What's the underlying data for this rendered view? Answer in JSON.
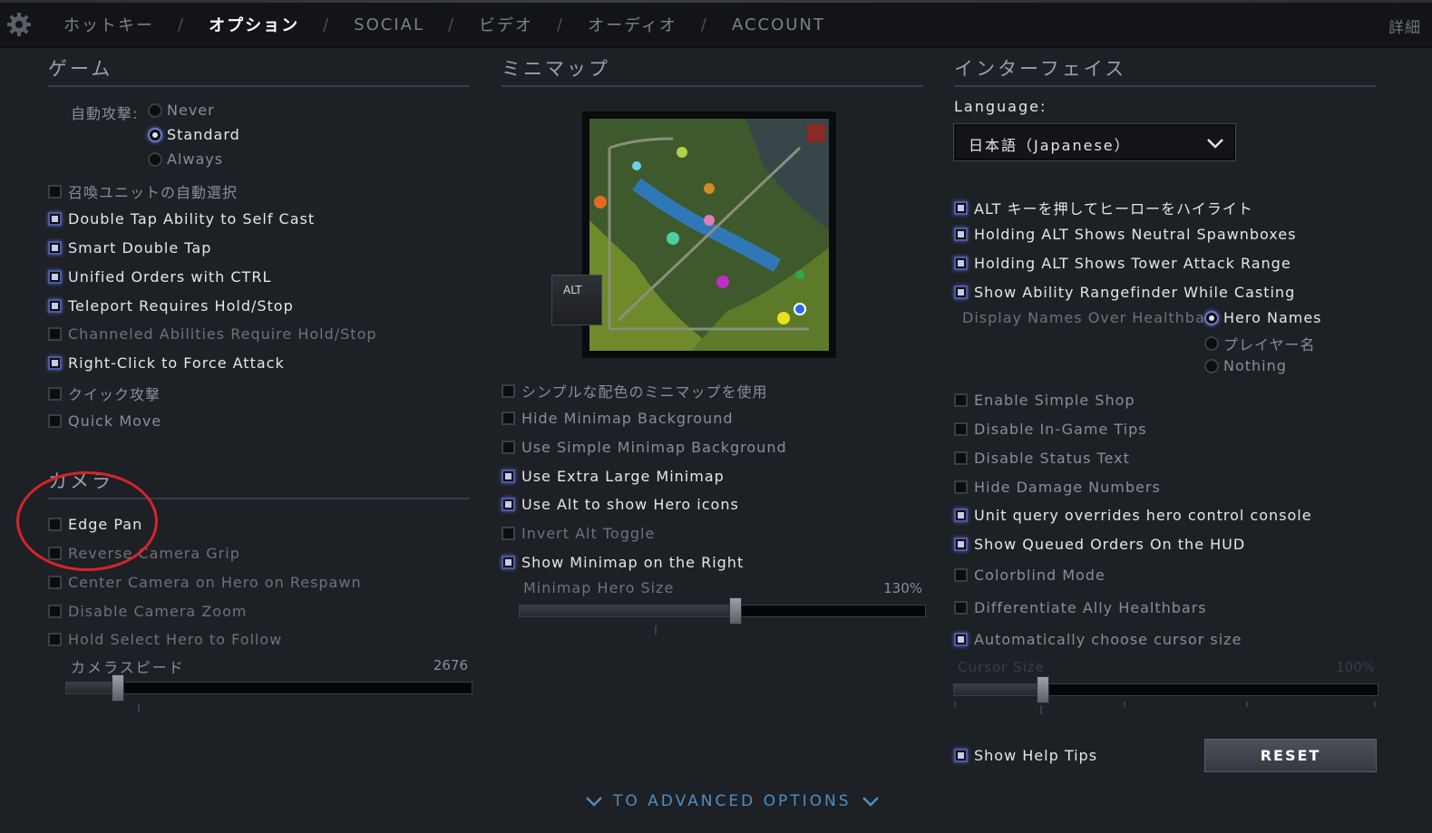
{
  "nav": {
    "tabs": [
      "ホットキー",
      "オプション",
      "SOCIAL",
      "ビデオ",
      "オーディオ",
      "ACCOUNT"
    ],
    "separator": "/",
    "detail_link": "詳細"
  },
  "game": {
    "header": "ゲーム",
    "auto_attack_label": "自動攻撃:",
    "auto_attack_options": [
      "Never",
      "Standard",
      "Always"
    ],
    "checkboxes": [
      "召喚ユニットの自動選択",
      "Double Tap Ability to Self Cast",
      "Smart Double Tap",
      "Unified Orders with CTRL",
      "Teleport Requires Hold/Stop",
      "Channeled Abilities Require Hold/Stop",
      "Right-Click to Force Attack",
      "クイック攻撃",
      "Quick Move"
    ]
  },
  "camera": {
    "header": "カメラ",
    "checkboxes": [
      "Edge Pan",
      "Reverse Camera Grip",
      "Center Camera on Hero on Respawn",
      "Disable Camera Zoom",
      "Hold Select Hero to Follow"
    ],
    "speed_label": "カメラスピード",
    "speed_value": "2676"
  },
  "minimap": {
    "header": "ミニマップ",
    "alt_key": "ALT",
    "checkboxes": [
      "シンプルな配色のミニマップを使用",
      "Hide Minimap Background",
      "Use Simple Minimap Background",
      "Use Extra Large Minimap",
      "Use Alt to show Hero icons",
      "Invert Alt Toggle",
      "Show Minimap on the Right"
    ],
    "hero_size_label": "Minimap Hero Size",
    "hero_size_value": "130%"
  },
  "interface": {
    "header": "インターフェイス",
    "language_label": "Language:",
    "language_value": "日本語（Japanese）",
    "checkboxes_top": [
      "ALT キーを押してヒーローをハイライト",
      "Holding ALT Shows Neutral Spawnboxes",
      "Holding ALT Shows Tower Attack Range",
      "Show Ability Rangefinder While Casting"
    ],
    "display_names_label": "Display Names Over Healthbar",
    "display_names_options": [
      "Hero Names",
      "プレイヤー名",
      "Nothing"
    ],
    "checkboxes_bottom": [
      "Enable Simple Shop",
      "Disable In-Game Tips",
      "Disable Status Text",
      "Hide Damage Numbers",
      "Unit query overrides hero control console",
      "Show Queued Orders On the HUD",
      "Colorblind Mode",
      "Differentiate Ally Healthbars",
      "Automatically choose cursor size"
    ],
    "cursor_size_label": "Cursor Size",
    "cursor_size_value": "100%",
    "help_tips_label": "Show Help Tips",
    "reset_label": "RESET"
  },
  "footer": {
    "advanced_label": "TO ADVANCED OPTIONS"
  },
  "colors": {
    "accent_blue": "#4d8fc4",
    "checkbox_glow": "#5f6ed2",
    "annotation_red": "#d8232b"
  }
}
